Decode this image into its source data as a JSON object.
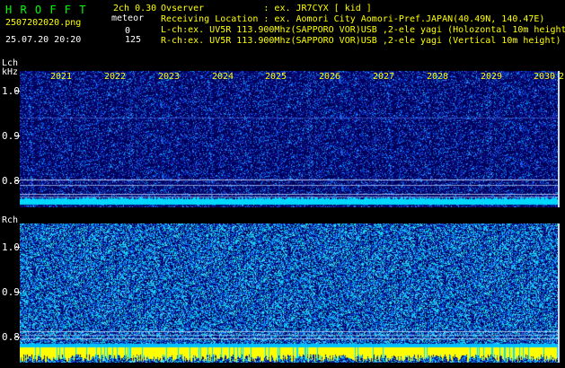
{
  "header": {
    "title": "H R O F F T",
    "mode": "2ch 0.30",
    "filename": "2507202020.png",
    "timestamp": "25.07.20 20:20",
    "meteor_label": "meteor",
    "meteor_lch": "0",
    "meteor_rch": "125",
    "observer": "Ovserver           : ex. JR7CYX [ kid ]",
    "location": "Receiving Location : ex. Aomori City Aomori-Pref.JAPAN(40.49N, 140.47E)",
    "lch_info": "L-ch:ex. UV5R 113.900Mhz(SAPPORO VOR)USB ,2-ele yagi (Holozontal 10m height)",
    "rch_info": "R-ch:ex. UV5R 113.900Mhz(SAPPORO VOR)USB ,2-ele yagi (Vertical 10m height)"
  },
  "lch": {
    "label": "Lch",
    "unit": "kHz",
    "ticks": [
      "1.0",
      "0.9",
      "0.8"
    ]
  },
  "rch": {
    "label": "Rch",
    "ticks": [
      "1.0",
      "0.9",
      "0.8"
    ]
  },
  "time_axis": {
    "labels": [
      "2021",
      "2022",
      "2023",
      "2024",
      "2025",
      "2026",
      "2027",
      "2028",
      "2029",
      "2030",
      "2"
    ]
  },
  "colors": {
    "header_green": "#00ff00",
    "header_yellow": "#ffff00",
    "text_white": "#ffffff",
    "band_cyan": "#00d8ff",
    "band_yellow": "#ffff00",
    "bg_navy": "#00005a"
  }
}
